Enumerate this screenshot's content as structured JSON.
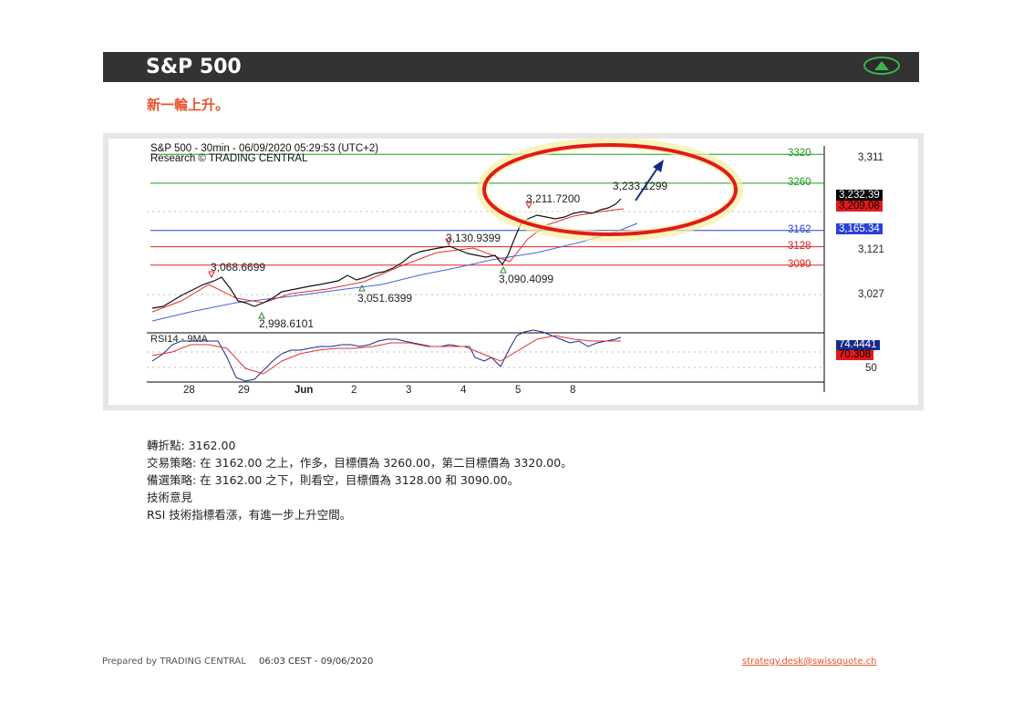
{
  "header": {
    "title": "S&P 500",
    "badge_icon": "up-triangle-icon"
  },
  "subtitle": "新一輪上升。",
  "chart_data": {
    "type": "candlestick",
    "title": "S&P 500 - 30min - 06/09/2020 05:29:53 (UTC+2)",
    "source": "Research © TRADING CENTRAL",
    "price_axis_ticks": [
      "3,311",
      "3,121",
      "3,027"
    ],
    "last_price": "3,232.39",
    "ma_price": "3,209.08",
    "blue_ma_price": "3,165.34",
    "levels": [
      {
        "label": "3320",
        "value": 3320,
        "color": "#1e9a1e"
      },
      {
        "label": "3260",
        "value": 3260,
        "color": "#1e9a1e"
      },
      {
        "label": "3162",
        "value": 3162,
        "color": "#2a3fd8"
      },
      {
        "label": "3128",
        "value": 3128,
        "color": "#e02020"
      },
      {
        "label": "3090",
        "value": 3090,
        "color": "#e02020"
      }
    ],
    "annotations": [
      "3,068.6699",
      "2,998.6101",
      "3,051.6399",
      "3,130.9399",
      "3,090.4099",
      "3,211.7200",
      "3,233.1299"
    ],
    "rsi": {
      "label": "RSI14 - 9MA",
      "value": "74.4441",
      "ma": "70.308",
      "tick": "50"
    },
    "x_ticks": [
      "28",
      "29",
      "Jun",
      "2",
      "3",
      "4",
      "5",
      "8"
    ]
  },
  "pivot": {
    "label": "轉折點:",
    "value": "3162.00"
  },
  "strategy": "交易策略: 在 3162.00 之上，作多，目標價為  3260.00，第二目標價為 3320.00。",
  "alternative": "備選策略: 在 3162.00 之下，則看空，目標價為  3128.00 和 3090.00。",
  "comment_title": "技術意見",
  "comment": "RSI 技術指標看漲，有進一步上升空間。",
  "footer": {
    "prepared": "Prepared by TRADING CENTRAL",
    "timestamp": "06:03 CEST - 09/06/2020",
    "email": "strategy.desk@swissquote.ch"
  }
}
